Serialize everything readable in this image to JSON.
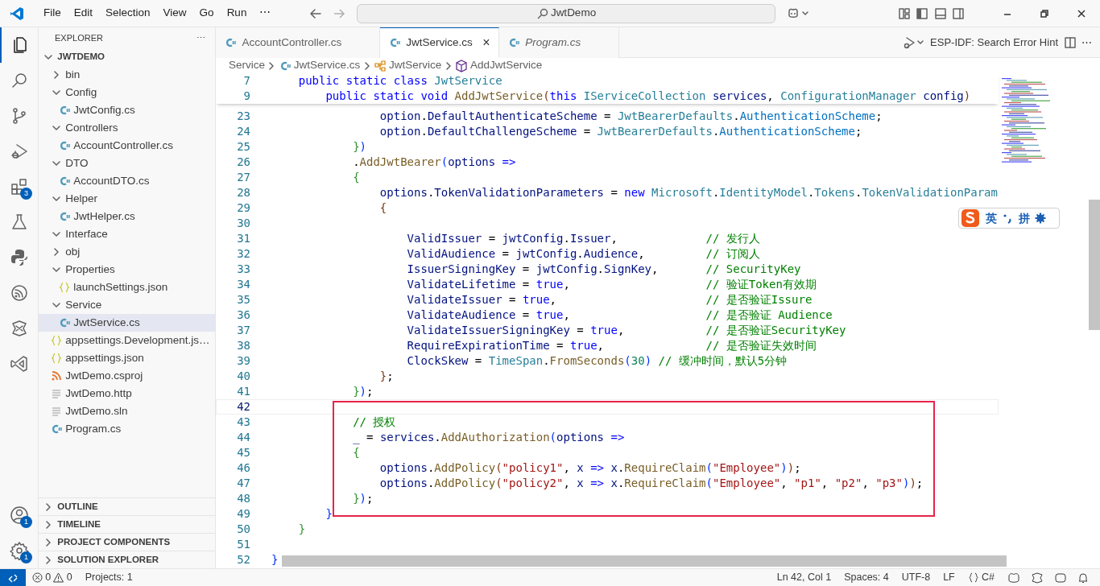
{
  "title_bar": {
    "menus": [
      "File",
      "Edit",
      "Selection",
      "View",
      "Go",
      "Run",
      "⋯"
    ],
    "search": "JwtDemo"
  },
  "activity_bar": {
    "top": [
      {
        "selected": true
      },
      {
        "selected": false
      },
      {
        "selected": false
      },
      {
        "selected": false
      },
      {
        "selected": false,
        "badge": "3"
      },
      {
        "selected": false
      },
      {
        "selected": false
      },
      {
        "selected": false
      },
      {
        "selected": false
      },
      {
        "selected": false
      }
    ],
    "bottom": [
      {
        "badge": "1"
      },
      {
        "badge": "1"
      }
    ]
  },
  "explorer": {
    "title": "EXPLORER",
    "more": "⋯",
    "root": {
      "label": "JWTDEMO",
      "expanded": true,
      "children": [
        {
          "label": "bin",
          "kind": "folder",
          "expanded": false,
          "selected": false
        },
        {
          "label": "Config",
          "kind": "folder",
          "expanded": true,
          "selected": false,
          "children": [
            {
              "label": "JwtConfig.cs",
              "kind": "cs",
              "selected": false
            }
          ]
        },
        {
          "label": "Controllers",
          "kind": "folder",
          "expanded": true,
          "selected": false,
          "children": [
            {
              "label": "AccountController.cs",
              "kind": "cs",
              "selected": false
            }
          ]
        },
        {
          "label": "DTO",
          "kind": "folder",
          "expanded": true,
          "selected": false,
          "children": [
            {
              "label": "AccountDTO.cs",
              "kind": "cs",
              "selected": false
            }
          ]
        },
        {
          "label": "Helper",
          "kind": "folder",
          "expanded": true,
          "selected": false,
          "children": [
            {
              "label": "JwtHelper.cs",
              "kind": "cs",
              "selected": false
            }
          ]
        },
        {
          "label": "Interface",
          "kind": "folder",
          "expanded": true,
          "selected": false
        },
        {
          "label": "obj",
          "kind": "folder",
          "expanded": false,
          "selected": false
        },
        {
          "label": "Properties",
          "kind": "folder",
          "expanded": true,
          "selected": false,
          "children": [
            {
              "label": "launchSettings.json",
              "kind": "json",
              "selected": false
            }
          ]
        },
        {
          "label": "Service",
          "kind": "folder",
          "expanded": true,
          "selected": false,
          "children": [
            {
              "label": "JwtService.cs",
              "kind": "cs",
              "selected": true
            }
          ]
        },
        {
          "label": "appsettings.Development.js…",
          "kind": "json",
          "selected": false
        },
        {
          "label": "appsettings.json",
          "kind": "json",
          "selected": false
        },
        {
          "label": "JwtDemo.csproj",
          "kind": "rss",
          "selected": false
        },
        {
          "label": "JwtDemo.http",
          "kind": "text",
          "selected": false
        },
        {
          "label": "JwtDemo.sln",
          "kind": "text",
          "selected": false
        },
        {
          "label": "Program.cs",
          "kind": "cs",
          "selected": false
        }
      ]
    }
  },
  "panels": [
    {
      "label": "OUTLINE",
      "expanded": false
    },
    {
      "label": "TIMELINE",
      "expanded": false
    },
    {
      "label": "PROJECT COMPONENTS",
      "expanded": false
    },
    {
      "label": "SOLUTION EXPLORER",
      "expanded": false
    }
  ],
  "tabs": [
    {
      "label": "AccountController.cs",
      "selected": false,
      "preview": false
    },
    {
      "label": "JwtService.cs",
      "selected": true,
      "preview": false,
      "close": "×"
    },
    {
      "label": "Program.cs",
      "selected": false,
      "preview": true
    }
  ],
  "editor_actions": {
    "label": "ESP-IDF: Search Error Hint",
    "more": "⋯"
  },
  "breadcrumbs": [
    {
      "label": "Service",
      "kind": "folder"
    },
    {
      "label": "JwtService.cs",
      "kind": "cs"
    },
    {
      "label": "JwtService",
      "kind": "class"
    },
    {
      "label": "AddJwtService",
      "kind": "method"
    }
  ],
  "sticky_lines": [
    {
      "number": "7",
      "tokens": [
        {
          "kind": "k",
          "text": "    public static class "
        },
        {
          "kind": "t",
          "text": "JwtService"
        }
      ]
    },
    {
      "number": "9",
      "tokens": [
        {
          "kind": "k",
          "text": "        public static void "
        },
        {
          "kind": "f",
          "text": "AddJwtService"
        },
        {
          "kind": "b3",
          "text": "("
        },
        {
          "kind": "k",
          "text": "this "
        },
        {
          "kind": "t",
          "text": "IServiceCollection "
        },
        {
          "kind": "v",
          "text": "services"
        },
        {
          "kind": "p",
          "text": ", "
        },
        {
          "kind": "t",
          "text": "ConfigurationManager "
        },
        {
          "kind": "v",
          "text": "config"
        },
        {
          "kind": "b3",
          "text": ")"
        }
      ]
    }
  ],
  "lines": [
    {
      "number": "23",
      "current": false,
      "tokens": [
        {
          "kind": "v",
          "text": "                option"
        },
        {
          "kind": "p",
          "text": "."
        },
        {
          "kind": "v",
          "text": "DefaultAuthenticateScheme"
        },
        {
          "kind": "p",
          "text": " = "
        },
        {
          "kind": "t",
          "text": "JwtBearerDefaults"
        },
        {
          "kind": "p",
          "text": "."
        },
        {
          "kind": "cn",
          "text": "AuthenticationScheme"
        },
        {
          "kind": "p",
          "text": ";"
        }
      ]
    },
    {
      "number": "24",
      "current": false,
      "tokens": [
        {
          "kind": "v",
          "text": "                option"
        },
        {
          "kind": "p",
          "text": "."
        },
        {
          "kind": "v",
          "text": "DefaultChallengeScheme"
        },
        {
          "kind": "p",
          "text": " = "
        },
        {
          "kind": "t",
          "text": "JwtBearerDefaults"
        },
        {
          "kind": "p",
          "text": "."
        },
        {
          "kind": "cn",
          "text": "AuthenticationScheme"
        },
        {
          "kind": "p",
          "text": ";"
        }
      ]
    },
    {
      "number": "25",
      "current": false,
      "tokens": [
        {
          "kind": "b2",
          "text": "            }"
        },
        {
          "kind": "b1",
          "text": ")"
        }
      ]
    },
    {
      "number": "26",
      "current": false,
      "tokens": [
        {
          "kind": "p",
          "text": "            ."
        },
        {
          "kind": "f",
          "text": "AddJwtBearer"
        },
        {
          "kind": "b1",
          "text": "("
        },
        {
          "kind": "v",
          "text": "options "
        },
        {
          "kind": "k",
          "text": "=>"
        }
      ]
    },
    {
      "number": "27",
      "current": false,
      "tokens": [
        {
          "kind": "b2",
          "text": "            {"
        }
      ]
    },
    {
      "number": "28",
      "current": false,
      "tokens": [
        {
          "kind": "v",
          "text": "                options"
        },
        {
          "kind": "p",
          "text": "."
        },
        {
          "kind": "v",
          "text": "TokenValidationParameters"
        },
        {
          "kind": "p",
          "text": " = "
        },
        {
          "kind": "k",
          "text": "new "
        },
        {
          "kind": "t",
          "text": "Microsoft"
        },
        {
          "kind": "p",
          "text": "."
        },
        {
          "kind": "t",
          "text": "IdentityModel"
        },
        {
          "kind": "p",
          "text": "."
        },
        {
          "kind": "t",
          "text": "Tokens"
        },
        {
          "kind": "p",
          "text": "."
        },
        {
          "kind": "t",
          "text": "TokenValidationParam"
        }
      ]
    },
    {
      "number": "29",
      "current": false,
      "tokens": [
        {
          "kind": "b3",
          "text": "                {"
        }
      ]
    },
    {
      "number": "30",
      "current": false
    },
    {
      "number": "31",
      "current": false,
      "tokens": [
        {
          "kind": "v",
          "text": "                    ValidIssuer"
        },
        {
          "kind": "p",
          "text": " = "
        },
        {
          "kind": "v",
          "text": "jwtConfig"
        },
        {
          "kind": "p",
          "text": "."
        },
        {
          "kind": "v",
          "text": "Issuer"
        },
        {
          "kind": "p",
          "text": ",             "
        },
        {
          "kind": "c",
          "text": "// 发行人"
        }
      ]
    },
    {
      "number": "32",
      "current": false,
      "tokens": [
        {
          "kind": "v",
          "text": "                    ValidAudience"
        },
        {
          "kind": "p",
          "text": " = "
        },
        {
          "kind": "v",
          "text": "jwtConfig"
        },
        {
          "kind": "p",
          "text": "."
        },
        {
          "kind": "v",
          "text": "Audience"
        },
        {
          "kind": "p",
          "text": ",         "
        },
        {
          "kind": "c",
          "text": "// 订阅人"
        }
      ]
    },
    {
      "number": "33",
      "current": false,
      "tokens": [
        {
          "kind": "v",
          "text": "                    IssuerSigningKey"
        },
        {
          "kind": "p",
          "text": " = "
        },
        {
          "kind": "v",
          "text": "jwtConfig"
        },
        {
          "kind": "p",
          "text": "."
        },
        {
          "kind": "v",
          "text": "SignKey"
        },
        {
          "kind": "p",
          "text": ",       "
        },
        {
          "kind": "c",
          "text": "// SecurityKey"
        }
      ]
    },
    {
      "number": "34",
      "current": false,
      "tokens": [
        {
          "kind": "v",
          "text": "                    ValidateLifetime"
        },
        {
          "kind": "p",
          "text": " = "
        },
        {
          "kind": "k",
          "text": "true"
        },
        {
          "kind": "p",
          "text": ",                    "
        },
        {
          "kind": "c",
          "text": "// 验证Token有效期"
        }
      ]
    },
    {
      "number": "35",
      "current": false,
      "tokens": [
        {
          "kind": "v",
          "text": "                    ValidateIssuer"
        },
        {
          "kind": "p",
          "text": " = "
        },
        {
          "kind": "k",
          "text": "true"
        },
        {
          "kind": "p",
          "text": ",                      "
        },
        {
          "kind": "c",
          "text": "// 是否验证Issure"
        }
      ]
    },
    {
      "number": "36",
      "current": false,
      "tokens": [
        {
          "kind": "v",
          "text": "                    ValidateAudience"
        },
        {
          "kind": "p",
          "text": " = "
        },
        {
          "kind": "k",
          "text": "true"
        },
        {
          "kind": "p",
          "text": ",                    "
        },
        {
          "kind": "c",
          "text": "// 是否验证 Audience"
        }
      ]
    },
    {
      "number": "37",
      "current": false,
      "tokens": [
        {
          "kind": "v",
          "text": "                    ValidateIssuerSigningKey"
        },
        {
          "kind": "p",
          "text": " = "
        },
        {
          "kind": "k",
          "text": "true"
        },
        {
          "kind": "p",
          "text": ",            "
        },
        {
          "kind": "c",
          "text": "// 是否验证SecurityKey"
        }
      ]
    },
    {
      "number": "38",
      "current": false,
      "tokens": [
        {
          "kind": "v",
          "text": "                    RequireExpirationTime"
        },
        {
          "kind": "p",
          "text": " = "
        },
        {
          "kind": "k",
          "text": "true"
        },
        {
          "kind": "p",
          "text": ",               "
        },
        {
          "kind": "c",
          "text": "// 是否验证失效时间"
        }
      ]
    },
    {
      "number": "39",
      "current": false,
      "tokens": [
        {
          "kind": "v",
          "text": "                    ClockSkew"
        },
        {
          "kind": "p",
          "text": " = "
        },
        {
          "kind": "t",
          "text": "TimeSpan"
        },
        {
          "kind": "p",
          "text": "."
        },
        {
          "kind": "f",
          "text": "FromSeconds"
        },
        {
          "kind": "b1",
          "text": "("
        },
        {
          "kind": "n",
          "text": "30"
        },
        {
          "kind": "b1",
          "text": ")"
        },
        {
          "kind": "c",
          "text": " // 缓冲时间，默认5分钟"
        }
      ]
    },
    {
      "number": "40",
      "current": false,
      "tokens": [
        {
          "kind": "b3",
          "text": "                }"
        },
        {
          "kind": "p",
          "text": ";"
        }
      ]
    },
    {
      "number": "41",
      "current": false,
      "tokens": [
        {
          "kind": "b2",
          "text": "            }"
        },
        {
          "kind": "b1",
          "text": ")"
        },
        {
          "kind": "p",
          "text": ";"
        }
      ]
    },
    {
      "number": "42",
      "current": true
    },
    {
      "number": "43",
      "current": false,
      "tokens": [
        {
          "kind": "c",
          "text": "            // 授权"
        }
      ]
    },
    {
      "number": "44",
      "current": false,
      "tokens": [
        {
          "kind": "v",
          "text": "            _"
        },
        {
          "kind": "p",
          "text": " = "
        },
        {
          "kind": "v",
          "text": "services"
        },
        {
          "kind": "p",
          "text": "."
        },
        {
          "kind": "f",
          "text": "AddAuthorization"
        },
        {
          "kind": "b1",
          "text": "("
        },
        {
          "kind": "v",
          "text": "options "
        },
        {
          "kind": "k",
          "text": "=>"
        }
      ]
    },
    {
      "number": "45",
      "current": false,
      "tokens": [
        {
          "kind": "b2",
          "text": "            {"
        }
      ]
    },
    {
      "number": "46",
      "current": false,
      "tokens": [
        {
          "kind": "v",
          "text": "                options"
        },
        {
          "kind": "p",
          "text": "."
        },
        {
          "kind": "f",
          "text": "AddPolicy"
        },
        {
          "kind": "b3",
          "text": "("
        },
        {
          "kind": "s",
          "text": "\"policy1\""
        },
        {
          "kind": "p",
          "text": ", "
        },
        {
          "kind": "v",
          "text": "x "
        },
        {
          "kind": "k",
          "text": "=> "
        },
        {
          "kind": "v",
          "text": "x"
        },
        {
          "kind": "p",
          "text": "."
        },
        {
          "kind": "f",
          "text": "RequireClaim"
        },
        {
          "kind": "b1",
          "text": "("
        },
        {
          "kind": "s",
          "text": "\"Employee\""
        },
        {
          "kind": "b1",
          "text": ")"
        },
        {
          "kind": "b3",
          "text": ")"
        },
        {
          "kind": "p",
          "text": ";"
        }
      ]
    },
    {
      "number": "47",
      "current": false,
      "tokens": [
        {
          "kind": "v",
          "text": "                options"
        },
        {
          "kind": "p",
          "text": "."
        },
        {
          "kind": "f",
          "text": "AddPolicy"
        },
        {
          "kind": "b3",
          "text": "("
        },
        {
          "kind": "s",
          "text": "\"policy2\""
        },
        {
          "kind": "p",
          "text": ", "
        },
        {
          "kind": "v",
          "text": "x "
        },
        {
          "kind": "k",
          "text": "=> "
        },
        {
          "kind": "v",
          "text": "x"
        },
        {
          "kind": "p",
          "text": "."
        },
        {
          "kind": "f",
          "text": "RequireClaim"
        },
        {
          "kind": "b1",
          "text": "("
        },
        {
          "kind": "s",
          "text": "\"Employee\""
        },
        {
          "kind": "p",
          "text": ", "
        },
        {
          "kind": "s",
          "text": "\"p1\""
        },
        {
          "kind": "p",
          "text": ", "
        },
        {
          "kind": "s",
          "text": "\"p2\""
        },
        {
          "kind": "p",
          "text": ", "
        },
        {
          "kind": "s",
          "text": "\"p3\""
        },
        {
          "kind": "b1",
          "text": ")"
        },
        {
          "kind": "b3",
          "text": ")"
        },
        {
          "kind": "p",
          "text": ";"
        }
      ]
    },
    {
      "number": "48",
      "current": false,
      "tokens": [
        {
          "kind": "b2",
          "text": "            }"
        },
        {
          "kind": "b1",
          "text": ")"
        },
        {
          "kind": "p",
          "text": ";"
        }
      ]
    },
    {
      "number": "49",
      "current": false,
      "tokens": [
        {
          "kind": "b1",
          "text": "        }"
        }
      ]
    },
    {
      "number": "50",
      "current": false,
      "tokens": [
        {
          "kind": "b2",
          "text": "    }"
        }
      ]
    },
    {
      "number": "51",
      "current": false
    },
    {
      "number": "52",
      "current": false,
      "tokens": [
        {
          "kind": "b1",
          "text": "}"
        }
      ]
    }
  ],
  "ime_toolbar": {
    "mode": "英",
    "input": "拼"
  },
  "status_bar": {
    "errors": "0",
    "warnings": "0",
    "projects": "Projects: 1",
    "right": [
      "Ln 42, Col 1",
      "Spaces: 4",
      "UTF-8",
      "LF",
      "C#"
    ]
  }
}
